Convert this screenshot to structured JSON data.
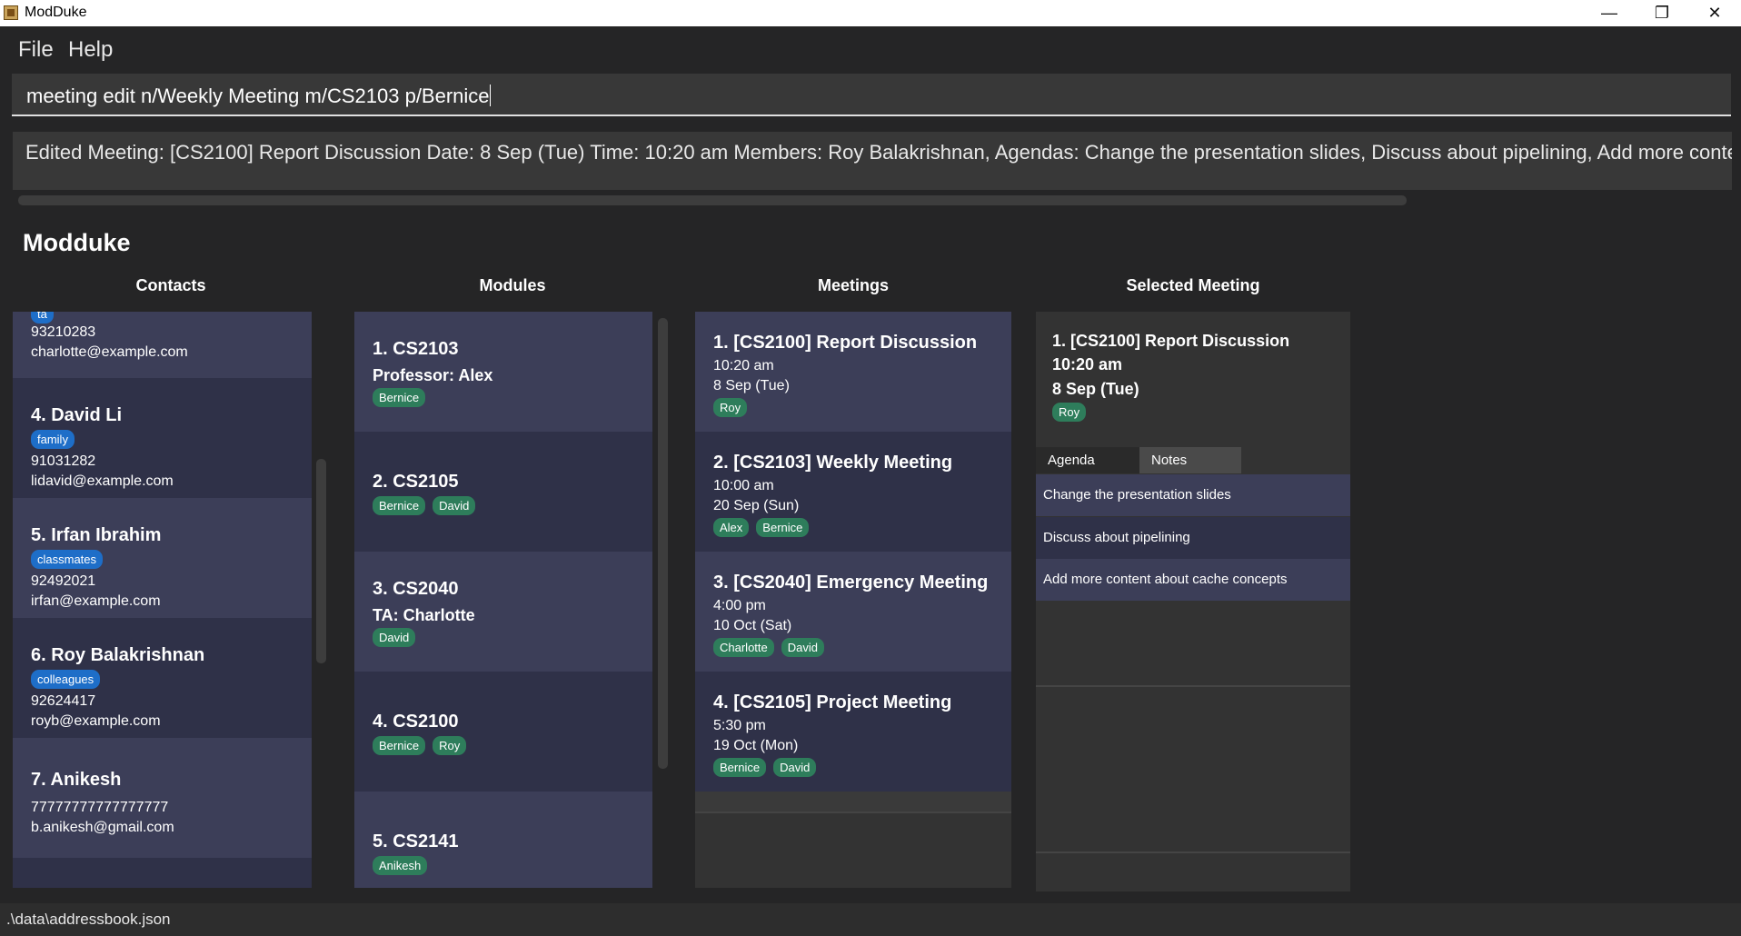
{
  "window": {
    "title": "ModDuke",
    "minimize": "—",
    "restore": "❐",
    "close": "✕"
  },
  "menu": {
    "file": "File",
    "help": "Help"
  },
  "command": {
    "value": "meeting edit n/Weekly Meeting m/CS2103 p/Bernice"
  },
  "result": {
    "text": "Edited Meeting: [CS2100] Report Discussion Date: 8 Sep (Tue) Time: 10:20 am Members: Roy Balakrishnan,  Agendas: Change the presentation slides, Discuss about pipelining, Add more content about cache c"
  },
  "app_heading": "Modduke",
  "columns": {
    "contacts": "Contacts",
    "modules": "Modules",
    "meetings": "Meetings",
    "selected": "Selected Meeting"
  },
  "contacts": {
    "partial": {
      "tag": "ta",
      "phone": "93210283",
      "email": "charlotte@example.com"
    },
    "items": [
      {
        "head": "4.  David Li",
        "tag": "family",
        "phone": "91031282",
        "email": "lidavid@example.com"
      },
      {
        "head": "5.  Irfan Ibrahim",
        "tag": "classmates",
        "phone": "92492021",
        "email": "irfan@example.com"
      },
      {
        "head": "6.  Roy Balakrishnan",
        "tag": "colleagues",
        "phone": "92624417",
        "email": "royb@example.com"
      },
      {
        "head": "7.  Anikesh",
        "phone": "77777777777777777",
        "email": "b.anikesh@gmail.com"
      }
    ]
  },
  "modules": [
    {
      "head": "1.  CS2103",
      "sub": "Professor: Alex",
      "tags": [
        "Bernice"
      ]
    },
    {
      "head": "2.  CS2105",
      "tags": [
        "Bernice",
        "David"
      ]
    },
    {
      "head": "3.  CS2040",
      "sub": "TA: Charlotte",
      "tags": [
        "David"
      ]
    },
    {
      "head": "4.  CS2100",
      "tags": [
        "Bernice",
        "Roy"
      ]
    },
    {
      "head": "5.  CS2141",
      "tags": [
        "Anikesh"
      ]
    }
  ],
  "meetings": [
    {
      "head": "1.  [CS2100] Report Discussion",
      "time": "10:20 am",
      "date": "8 Sep (Tue)",
      "tags": [
        "Roy"
      ]
    },
    {
      "head": "2.  [CS2103] Weekly Meeting",
      "time": "10:00 am",
      "date": "20 Sep (Sun)",
      "tags": [
        "Alex",
        "Bernice"
      ]
    },
    {
      "head": "3.  [CS2040] Emergency Meeting",
      "time": "4:00 pm",
      "date": "10 Oct (Sat)",
      "tags": [
        "Charlotte",
        "David"
      ]
    },
    {
      "head": "4.  [CS2105] Project Meeting",
      "time": "5:30 pm",
      "date": "19 Oct (Mon)",
      "tags": [
        "Bernice",
        "David"
      ]
    }
  ],
  "selected": {
    "head": "1.  [CS2100] Report Discussion",
    "time": "10:20 am",
    "date": "8 Sep (Tue)",
    "tags": [
      "Roy"
    ],
    "tabs": {
      "agenda": "Agenda",
      "notes": "Notes"
    },
    "agendas": [
      "Change the presentation slides",
      "Discuss about pipelining",
      "Add more content about cache concepts"
    ]
  },
  "status": {
    "path": ".\\data\\addressbook.json"
  }
}
